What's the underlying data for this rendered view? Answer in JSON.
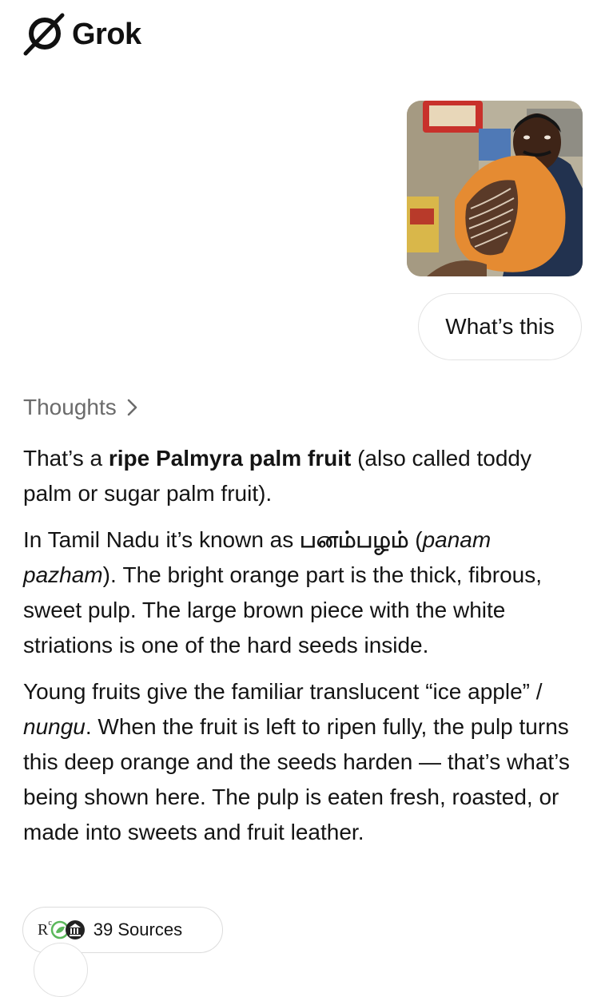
{
  "app": {
    "name": "Grok",
    "logo_icon": "grok-logo-icon"
  },
  "user_message": {
    "image": "photo of man holding halved ripe palmyra fruit",
    "text": "What’s this"
  },
  "thoughts": {
    "label": "Thoughts",
    "icon": "chevron-right-icon"
  },
  "answer": {
    "p1": {
      "a": "That’s a ",
      "b": "ripe Palmyra palm fruit",
      "c": " (also called toddy palm or sugar palm fruit)."
    },
    "p2": {
      "a": "In Tamil Nadu it’s known as ",
      "b": "பனம்பழம்",
      "c": " (",
      "d": "panam pazham",
      "e": "). The bright orange part is the thick, fibrous, sweet pulp. The large brown piece with the white striations is one of the hard seeds inside."
    },
    "p3": {
      "a": "Young fruits give the familiar translucent “ice apple” / ",
      "b": "nungu",
      "c": ". When the fruit is left to ripen fully, the pulp turns this deep orange and the seeds harden — that’s what’s being shown here. The pulp is eaten fresh, roasted, or made into sweets and fruit leather."
    }
  },
  "sources": {
    "label": "39 Sources",
    "icon_r": "R",
    "icon_r_sup": "c",
    "icons": [
      "source-r-icon",
      "leaf-icon",
      "bank-icon"
    ]
  }
}
